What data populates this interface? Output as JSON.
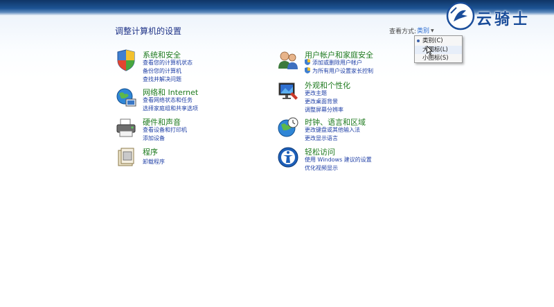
{
  "window": {
    "page_title": "调整计算机的设置"
  },
  "view_by": {
    "label": "查看方式:",
    "selected": "类别",
    "options": [
      "类别(C)",
      "大图标(L)",
      "小图标(S)"
    ]
  },
  "watermark": {
    "text": "云骑士"
  },
  "categories": [
    {
      "title": "系统和安全",
      "icon": "shield-pc-icon",
      "links": [
        "查看您的计算机状态",
        "备份您的计算机",
        "查找并解决问题"
      ]
    },
    {
      "title": "网络和 Internet",
      "icon": "network-globe-icon",
      "links": [
        "查看网络状态和任务",
        "选择家庭组和共享选项"
      ]
    },
    {
      "title": "硬件和声音",
      "icon": "printer-icon",
      "links": [
        "查看设备和打印机",
        "添加设备"
      ]
    },
    {
      "title": "程序",
      "icon": "programs-icon",
      "links": [
        "卸载程序"
      ]
    },
    {
      "title": "用户帐户和家庭安全",
      "icon": "users-icon",
      "links": [
        "添加或删除用户帐户",
        "为所有用户设置家长控制"
      ]
    },
    {
      "title": "外观和个性化",
      "icon": "monitor-icon",
      "links": [
        "更改主题",
        "更改桌面背景",
        "调整屏幕分辨率"
      ]
    },
    {
      "title": "时钟、语言和区域",
      "icon": "clock-globe-icon",
      "links": [
        "更改键盘或其他输入法",
        "更改显示语言"
      ]
    },
    {
      "title": "轻松访问",
      "icon": "ease-of-access-icon",
      "links": [
        "使用 Windows 建议的设置",
        "优化视频显示"
      ]
    }
  ],
  "colors": {
    "category_title": "#1e7a1e",
    "link": "#1f3fa6",
    "page_title": "#1e3287"
  }
}
